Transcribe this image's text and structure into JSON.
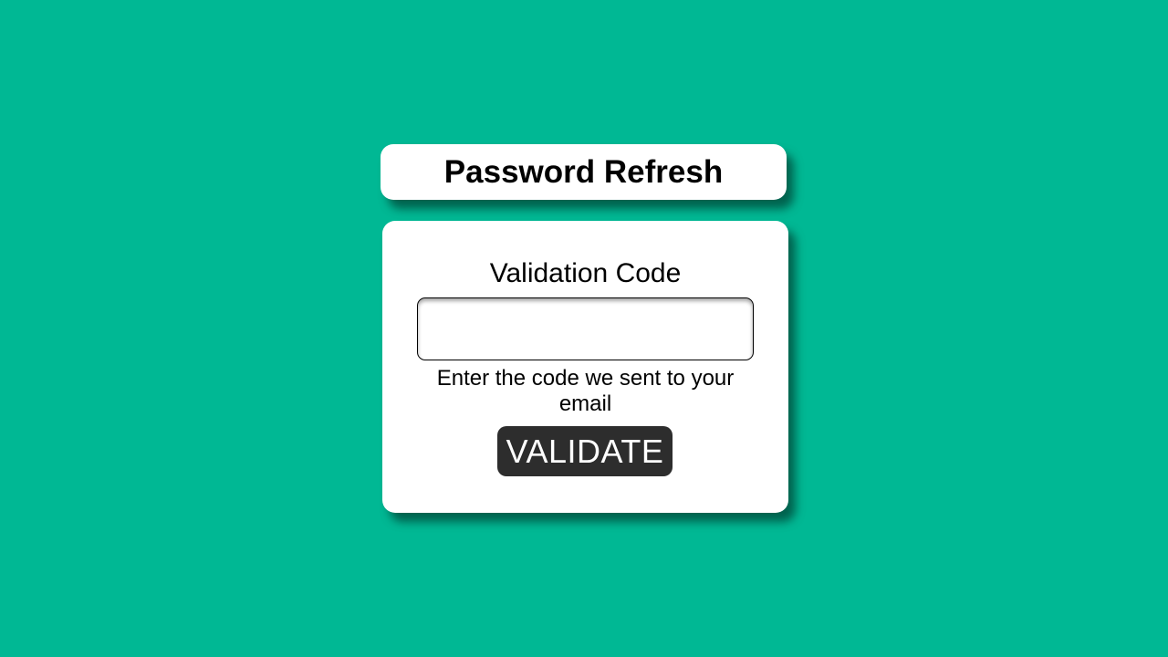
{
  "header": {
    "title": "Password Refresh"
  },
  "form": {
    "field_label": "Validation Code",
    "code_value": "",
    "hint": "Enter the code we sent to your email",
    "submit_label": "VALIDATE"
  },
  "colors": {
    "background": "#00b894",
    "card": "#ffffff",
    "button": "#2d2d2d",
    "button_text": "#ffffff"
  }
}
